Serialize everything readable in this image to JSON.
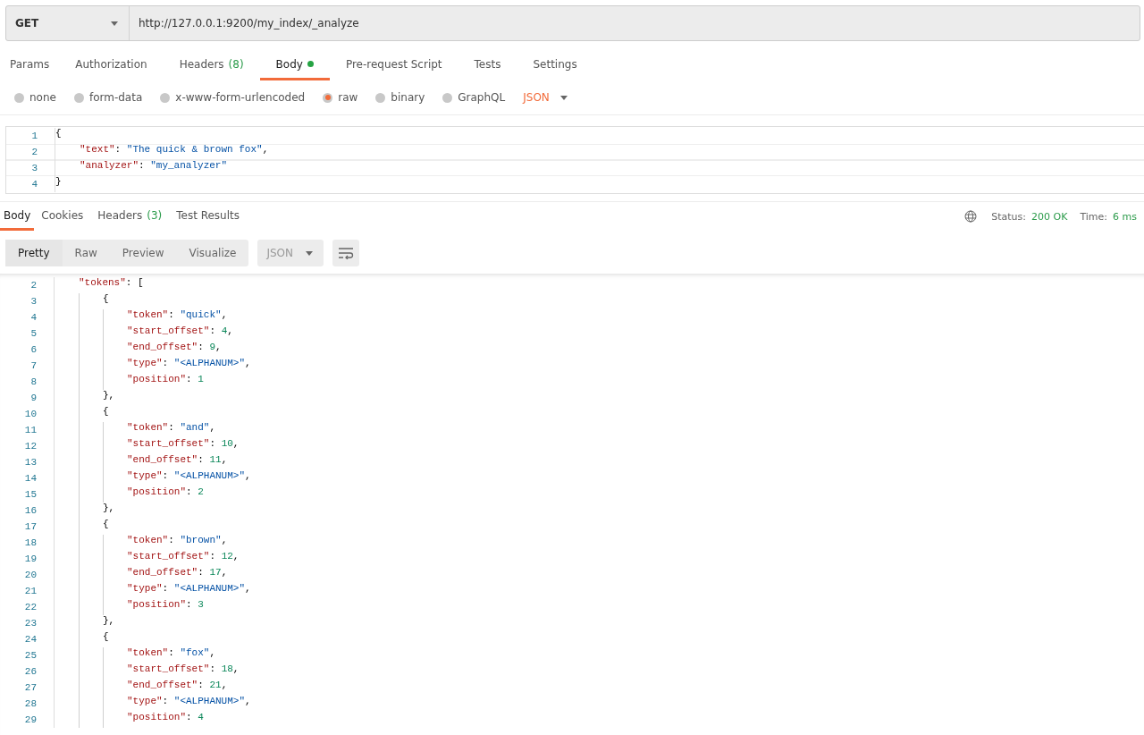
{
  "request": {
    "method": "GET",
    "url": "http://127.0.0.1:9200/my_index/_analyze"
  },
  "request_tabs": [
    {
      "label": "Params",
      "selected": false
    },
    {
      "label": "Authorization",
      "selected": false
    },
    {
      "label": "Headers",
      "count": "(8)",
      "selected": false
    },
    {
      "label": "Body",
      "dot": true,
      "selected": true
    },
    {
      "label": "Pre-request Script",
      "selected": false
    },
    {
      "label": "Tests",
      "selected": false
    },
    {
      "label": "Settings",
      "selected": false
    }
  ],
  "body_types": [
    {
      "label": "none",
      "selected": false
    },
    {
      "label": "form-data",
      "selected": false
    },
    {
      "label": "x-www-form-urlencoded",
      "selected": false
    },
    {
      "label": "raw",
      "selected": true
    },
    {
      "label": "binary",
      "selected": false
    },
    {
      "label": "GraphQL",
      "selected": false
    }
  ],
  "body_format": "JSON",
  "request_body": [
    {
      "n": "1",
      "parts": [
        {
          "kind": "punct",
          "text": "{"
        }
      ],
      "children": [
        {
          "n": "2",
          "parts": [
            {
              "kind": "key",
              "text": "\"text\""
            },
            {
              "kind": "punct",
              "text": ": "
            },
            {
              "kind": "string",
              "text": "\"The quick & brown fox\""
            },
            {
              "kind": "punct",
              "text": ","
            }
          ]
        },
        {
          "n": "3",
          "parts": [
            {
              "kind": "key",
              "text": "\"analyzer\""
            },
            {
              "kind": "punct",
              "text": ": "
            },
            {
              "kind": "string",
              "text": "\"my_analyzer\""
            }
          ]
        }
      ]
    },
    {
      "n": "4",
      "parts": [
        {
          "kind": "punct",
          "text": "}"
        }
      ]
    }
  ],
  "response_tabs": [
    {
      "label": "Body",
      "selected": true
    },
    {
      "label": "Cookies",
      "selected": false
    },
    {
      "label": "Headers",
      "count": "(3)",
      "selected": false
    },
    {
      "label": "Test Results",
      "selected": false
    }
  ],
  "status": {
    "label": "Status:",
    "value": "200 OK",
    "time_label": "Time:",
    "time": "6 ms"
  },
  "view_modes": [
    {
      "label": "Pretty",
      "selected": true
    },
    {
      "label": "Raw",
      "selected": false
    },
    {
      "label": "Preview",
      "selected": false
    },
    {
      "label": "Visualize",
      "selected": false
    }
  ],
  "response_format": "JSON",
  "response_body": [
    {
      "n": "2",
      "parts": [
        {
          "kind": "key",
          "text": "\"tokens\""
        },
        {
          "kind": "punct",
          "text": ": ["
        }
      ],
      "children": [
        {
          "n": "3",
          "parts": [
            {
              "kind": "punct",
              "text": "{"
            }
          ],
          "children": [
            {
              "n": "4",
              "parts": [
                {
                  "kind": "key",
                  "text": "\"token\""
                },
                {
                  "kind": "punct",
                  "text": ": "
                },
                {
                  "kind": "string",
                  "text": "\"quick\""
                },
                {
                  "kind": "punct",
                  "text": ","
                }
              ]
            },
            {
              "n": "5",
              "parts": [
                {
                  "kind": "key",
                  "text": "\"start_offset\""
                },
                {
                  "kind": "punct",
                  "text": ": "
                },
                {
                  "kind": "number",
                  "text": "4"
                },
                {
                  "kind": "punct",
                  "text": ","
                }
              ]
            },
            {
              "n": "6",
              "parts": [
                {
                  "kind": "key",
                  "text": "\"end_offset\""
                },
                {
                  "kind": "punct",
                  "text": ": "
                },
                {
                  "kind": "number",
                  "text": "9"
                },
                {
                  "kind": "punct",
                  "text": ","
                }
              ]
            },
            {
              "n": "7",
              "parts": [
                {
                  "kind": "key",
                  "text": "\"type\""
                },
                {
                  "kind": "punct",
                  "text": ": "
                },
                {
                  "kind": "string",
                  "text": "\"<ALPHANUM>\""
                },
                {
                  "kind": "punct",
                  "text": ","
                }
              ]
            },
            {
              "n": "8",
              "parts": [
                {
                  "kind": "key",
                  "text": "\"position\""
                },
                {
                  "kind": "punct",
                  "text": ": "
                },
                {
                  "kind": "number",
                  "text": "1"
                }
              ]
            }
          ]
        },
        {
          "n": "9",
          "parts": [
            {
              "kind": "punct",
              "text": "},"
            }
          ]
        },
        {
          "n": "10",
          "parts": [
            {
              "kind": "punct",
              "text": "{"
            }
          ],
          "children": [
            {
              "n": "11",
              "parts": [
                {
                  "kind": "key",
                  "text": "\"token\""
                },
                {
                  "kind": "punct",
                  "text": ": "
                },
                {
                  "kind": "string",
                  "text": "\"and\""
                },
                {
                  "kind": "punct",
                  "text": ","
                }
              ]
            },
            {
              "n": "12",
              "parts": [
                {
                  "kind": "key",
                  "text": "\"start_offset\""
                },
                {
                  "kind": "punct",
                  "text": ": "
                },
                {
                  "kind": "number",
                  "text": "10"
                },
                {
                  "kind": "punct",
                  "text": ","
                }
              ]
            },
            {
              "n": "13",
              "parts": [
                {
                  "kind": "key",
                  "text": "\"end_offset\""
                },
                {
                  "kind": "punct",
                  "text": ": "
                },
                {
                  "kind": "number",
                  "text": "11"
                },
                {
                  "kind": "punct",
                  "text": ","
                }
              ]
            },
            {
              "n": "14",
              "parts": [
                {
                  "kind": "key",
                  "text": "\"type\""
                },
                {
                  "kind": "punct",
                  "text": ": "
                },
                {
                  "kind": "string",
                  "text": "\"<ALPHANUM>\""
                },
                {
                  "kind": "punct",
                  "text": ","
                }
              ]
            },
            {
              "n": "15",
              "parts": [
                {
                  "kind": "key",
                  "text": "\"position\""
                },
                {
                  "kind": "punct",
                  "text": ": "
                },
                {
                  "kind": "number",
                  "text": "2"
                }
              ]
            }
          ]
        },
        {
          "n": "16",
          "parts": [
            {
              "kind": "punct",
              "text": "},"
            }
          ]
        },
        {
          "n": "17",
          "parts": [
            {
              "kind": "punct",
              "text": "{"
            }
          ],
          "children": [
            {
              "n": "18",
              "parts": [
                {
                  "kind": "key",
                  "text": "\"token\""
                },
                {
                  "kind": "punct",
                  "text": ": "
                },
                {
                  "kind": "string",
                  "text": "\"brown\""
                },
                {
                  "kind": "punct",
                  "text": ","
                }
              ]
            },
            {
              "n": "19",
              "parts": [
                {
                  "kind": "key",
                  "text": "\"start_offset\""
                },
                {
                  "kind": "punct",
                  "text": ": "
                },
                {
                  "kind": "number",
                  "text": "12"
                },
                {
                  "kind": "punct",
                  "text": ","
                }
              ]
            },
            {
              "n": "20",
              "parts": [
                {
                  "kind": "key",
                  "text": "\"end_offset\""
                },
                {
                  "kind": "punct",
                  "text": ": "
                },
                {
                  "kind": "number",
                  "text": "17"
                },
                {
                  "kind": "punct",
                  "text": ","
                }
              ]
            },
            {
              "n": "21",
              "parts": [
                {
                  "kind": "key",
                  "text": "\"type\""
                },
                {
                  "kind": "punct",
                  "text": ": "
                },
                {
                  "kind": "string",
                  "text": "\"<ALPHANUM>\""
                },
                {
                  "kind": "punct",
                  "text": ","
                }
              ]
            },
            {
              "n": "22",
              "parts": [
                {
                  "kind": "key",
                  "text": "\"position\""
                },
                {
                  "kind": "punct",
                  "text": ": "
                },
                {
                  "kind": "number",
                  "text": "3"
                }
              ]
            }
          ]
        },
        {
          "n": "23",
          "parts": [
            {
              "kind": "punct",
              "text": "},"
            }
          ]
        },
        {
          "n": "24",
          "parts": [
            {
              "kind": "punct",
              "text": "{"
            }
          ],
          "children": [
            {
              "n": "25",
              "parts": [
                {
                  "kind": "key",
                  "text": "\"token\""
                },
                {
                  "kind": "punct",
                  "text": ": "
                },
                {
                  "kind": "string",
                  "text": "\"fox\""
                },
                {
                  "kind": "punct",
                  "text": ","
                }
              ]
            },
            {
              "n": "26",
              "parts": [
                {
                  "kind": "key",
                  "text": "\"start_offset\""
                },
                {
                  "kind": "punct",
                  "text": ": "
                },
                {
                  "kind": "number",
                  "text": "18"
                },
                {
                  "kind": "punct",
                  "text": ","
                }
              ]
            },
            {
              "n": "27",
              "parts": [
                {
                  "kind": "key",
                  "text": "\"end_offset\""
                },
                {
                  "kind": "punct",
                  "text": ": "
                },
                {
                  "kind": "number",
                  "text": "21"
                },
                {
                  "kind": "punct",
                  "text": ","
                }
              ]
            },
            {
              "n": "28",
              "parts": [
                {
                  "kind": "key",
                  "text": "\"type\""
                },
                {
                  "kind": "punct",
                  "text": ": "
                },
                {
                  "kind": "string",
                  "text": "\"<ALPHANUM>\""
                },
                {
                  "kind": "punct",
                  "text": ","
                }
              ]
            },
            {
              "n": "29",
              "parts": [
                {
                  "kind": "key",
                  "text": "\"position\""
                },
                {
                  "kind": "punct",
                  "text": ": "
                },
                {
                  "kind": "number",
                  "text": "4"
                }
              ]
            }
          ]
        }
      ]
    }
  ]
}
